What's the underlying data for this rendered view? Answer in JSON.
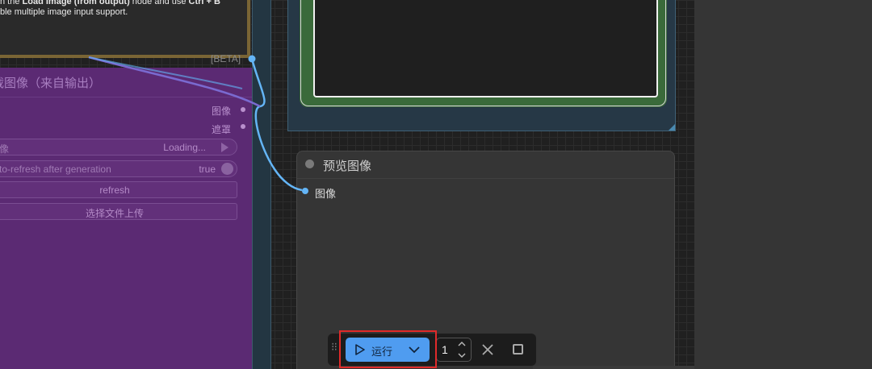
{
  "note_node": {
    "line1_prefix": "n the ",
    "line1_bold1": "Load Image (from output)",
    "line1_mid": " node and use ",
    "line1_bold2": "Ctrl + B",
    "line2": "ble multiple image input support.",
    "badge": "[BETA]"
  },
  "load_image_output_node": {
    "title": "载图像（来自输出）",
    "outputs": [
      {
        "label": "图像"
      },
      {
        "label": "遮罩"
      }
    ],
    "image_widget": {
      "label": "像",
      "value": "Loading..."
    },
    "auto_refresh": {
      "label": "to-refresh after generation",
      "value": "true"
    },
    "refresh_button": "refresh",
    "upload_button": "选择文件上传"
  },
  "preview_node": {
    "title": "预览图像",
    "input_label": "图像"
  },
  "run_toolbar": {
    "run_label": "运行",
    "batch_count": "1"
  },
  "colors": {
    "accent": "#4f9cf0",
    "link_wire": "#64b5f6",
    "purple_node": "#5b2a73",
    "highlight": "#e02a2a"
  }
}
